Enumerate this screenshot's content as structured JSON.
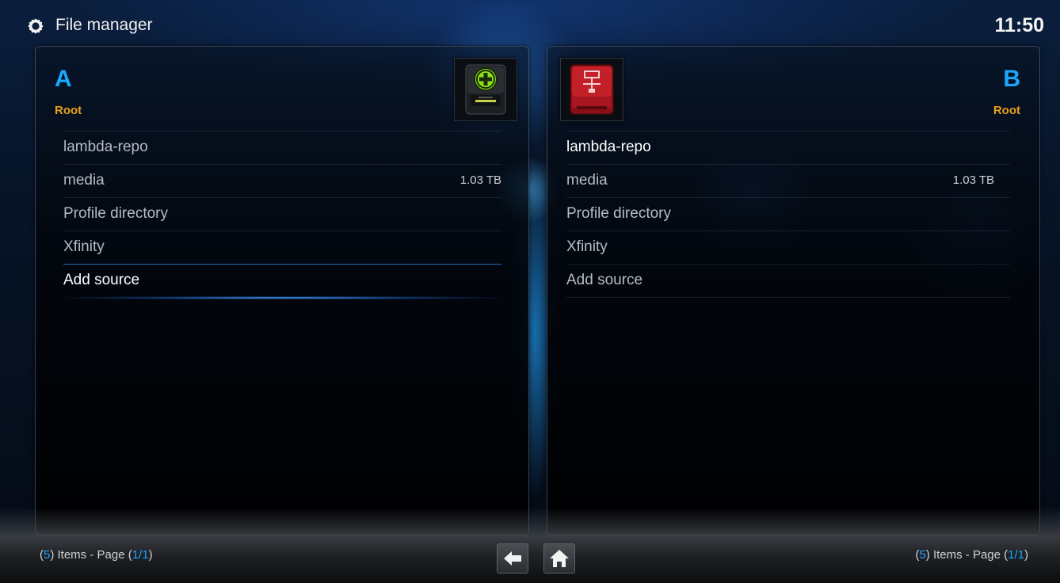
{
  "header": {
    "title": "File manager",
    "clock": "11:50"
  },
  "panels": {
    "a": {
      "letter": "A",
      "path": "Root",
      "items": [
        {
          "label": "lambda-repo",
          "size": ""
        },
        {
          "label": "media",
          "size": "1.03 TB"
        },
        {
          "label": "Profile directory",
          "size": ""
        },
        {
          "label": "Xfinity",
          "size": ""
        },
        {
          "label": "Add source",
          "size": ""
        }
      ],
      "focused_index": 4
    },
    "b": {
      "letter": "B",
      "path": "Root",
      "items": [
        {
          "label": "lambda-repo",
          "size": ""
        },
        {
          "label": "media",
          "size": "1.03 TB"
        },
        {
          "label": "Profile directory",
          "size": ""
        },
        {
          "label": "Xfinity",
          "size": ""
        },
        {
          "label": "Add source",
          "size": ""
        }
      ],
      "highlighted_index": 0
    }
  },
  "footer": {
    "a": {
      "open_paren": "(",
      "count": "5",
      "mid": ") Items - Page (",
      "page": "1/1",
      "close_paren": ")"
    },
    "b": {
      "open_paren": "(",
      "count": "5",
      "mid": ") Items - Page (",
      "page": "1/1",
      "close_paren": ")"
    }
  },
  "icons": {
    "settings": "gear-icon",
    "add_source": "add-drive-icon",
    "network_drive": "network-drive-icon",
    "back": "back-arrow-icon",
    "home": "home-icon"
  },
  "colors": {
    "accent": "#1aa7ff",
    "path": "#e8a21a",
    "drive_add_green": "#8fe01a",
    "drive_network_red": "#c4202a"
  }
}
